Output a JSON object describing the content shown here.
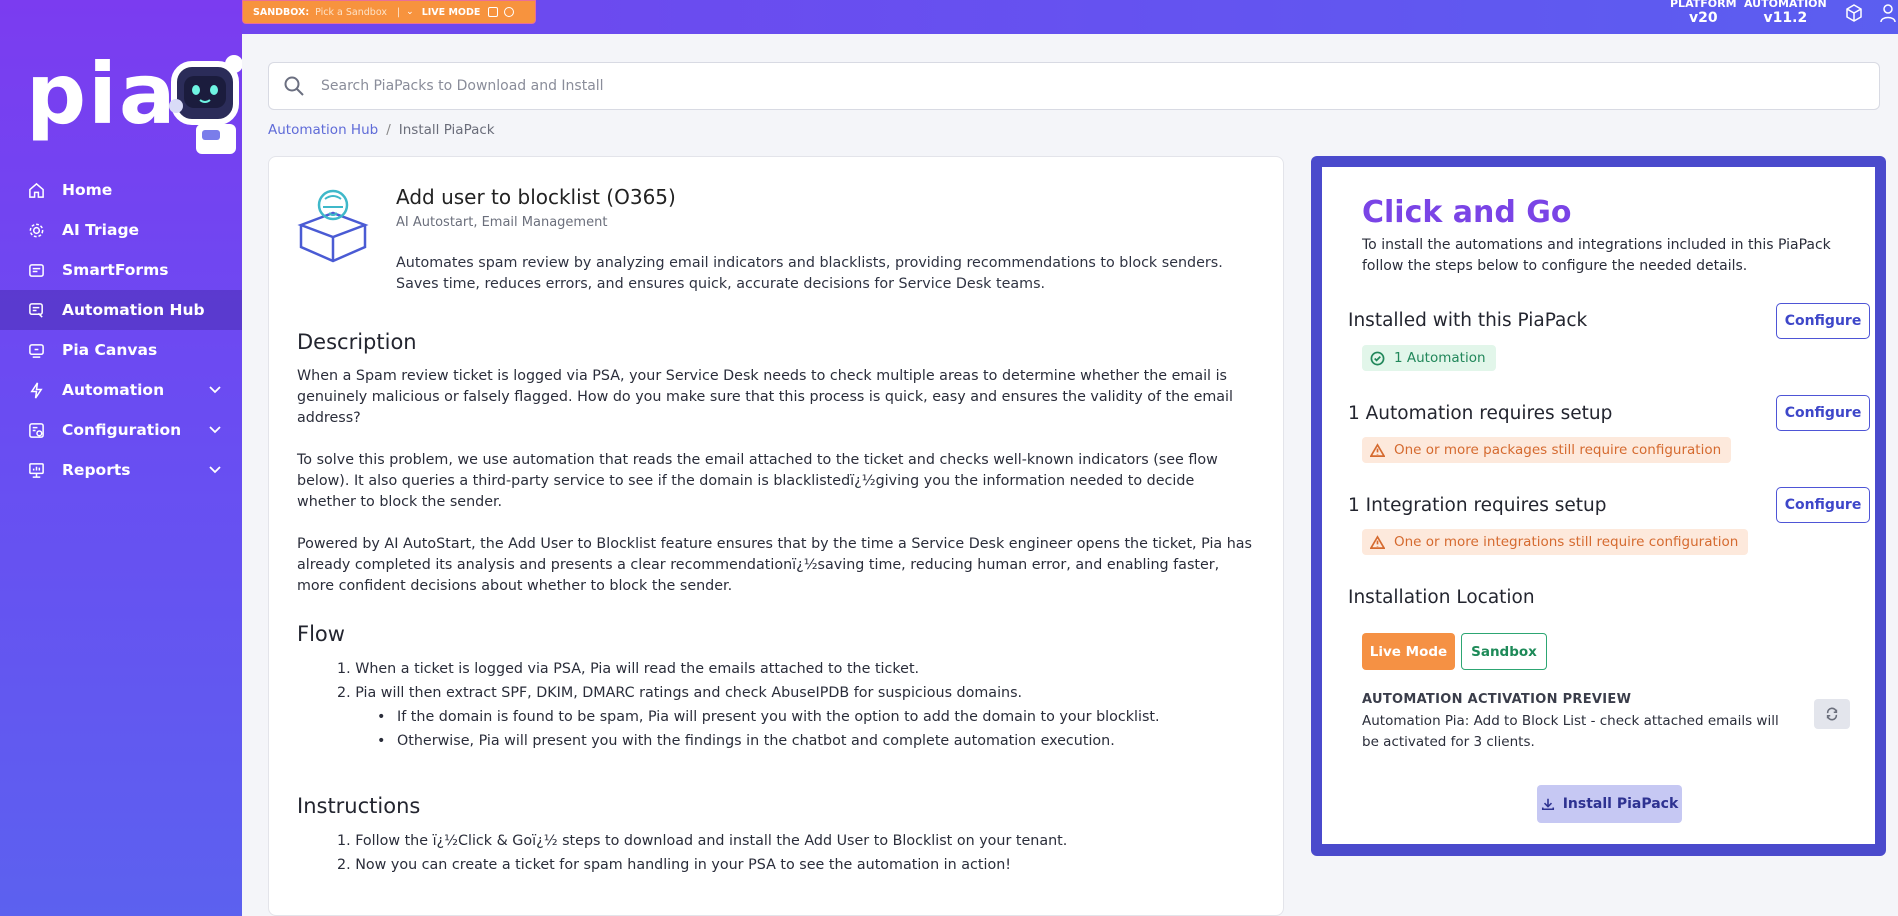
{
  "topbar": {
    "sandbox_label": "SANDBOX:",
    "sandbox_pick": "Pick a Sandbox",
    "live_mode": "LIVE MODE",
    "platform_label": "PLATFORM",
    "platform_version": "v20",
    "automation_label": "AUTOMATION",
    "automation_version": "v11.2",
    "icons": [
      "cube-icon",
      "user-icon"
    ]
  },
  "sidebar": {
    "logo": "pia",
    "items": [
      {
        "label": "Home",
        "icon": "home-icon"
      },
      {
        "label": "AI Triage",
        "icon": "gear-icon"
      },
      {
        "label": "SmartForms",
        "icon": "form-icon"
      },
      {
        "label": "Automation Hub",
        "icon": "hub-icon",
        "active": true
      },
      {
        "label": "Pia Canvas",
        "icon": "canvas-icon"
      },
      {
        "label": "Automation",
        "icon": "bolt-icon",
        "expandable": true
      },
      {
        "label": "Configuration",
        "icon": "config-icon",
        "expandable": true
      },
      {
        "label": "Reports",
        "icon": "report-icon",
        "expandable": true
      }
    ]
  },
  "search": {
    "placeholder": "Search PiaPacks to Download and Install",
    "value": ""
  },
  "breadcrumb": {
    "parent": "Automation Hub",
    "separator": "/",
    "current": "Install PiaPack"
  },
  "pack": {
    "title": "Add user to blocklist (O365)",
    "tags": "AI Autostart, Email Management",
    "summary": "Automates spam review by analyzing email indicators and blacklists, providing recommendations to block senders. Saves time, reduces errors, and ensures quick, accurate decisions for Service Desk teams.",
    "description_heading": "Description",
    "description_p1": "When a Spam review ticket is logged via PSA, your Service Desk needs to check multiple areas to determine whether the email is genuinely malicious or falsely flagged. How do you make sure that this process is quick, easy and ensures the validity of the email address?",
    "description_p2": "To solve this problem, we use automation that reads the email attached to the ticket and checks well-known indicators (see flow below). It also queries a third-party service to see if the domain is blacklistedï¿½giving you the information needed to decide whether to block the sender.",
    "description_p3": "Powered by AI AutoStart, the Add User to Blocklist feature ensures that by the time a Service Desk engineer opens the ticket, Pia has already completed its analysis and presents a clear recommendationï¿½saving time, reducing human error, and enabling faster, more confident decisions about whether to block the sender.",
    "flow_heading": "Flow",
    "flow_1": "When a ticket is logged via PSA, Pia will read the emails attached to the ticket.",
    "flow_2": "Pia will then extract SPF, DKIM, DMARC ratings and check AbuseIPDB for suspicious domains.",
    "flow_2a": "If the domain is found to be spam, Pia will present you with the option to add the domain to your blocklist.",
    "flow_2b": "Otherwise, Pia will present you with the findings in the chatbot and complete automation execution.",
    "instructions_heading": "Instructions",
    "instr_1": "Follow the ï¿½Click & Goï¿½ steps to download and install the Add User to Blocklist on your tenant.",
    "instr_2": "Now you can create a ticket for spam handling in your PSA to see the automation in action!"
  },
  "click_and_go": {
    "title": "Click and Go",
    "subtitle": "To install the automations and integrations included in this PiaPack follow the steps below to configure the needed details.",
    "installed_heading": "Installed with this PiaPack",
    "installed_badge": "1 Automation",
    "automation_heading": "1 Automation requires setup",
    "automation_badge": "One or more packages still require configuration",
    "integration_heading": "1 Integration requires setup",
    "integration_badge": "One or more integrations still require configuration",
    "configure_label": "Configure",
    "location_heading": "Installation Location",
    "live_mode_label": "Live Mode",
    "sandbox_label": "Sandbox",
    "preview_heading": "AUTOMATION ACTIVATION PREVIEW",
    "preview_text": "Automation Pia: Add to Block List - check attached emails will be activated for 3 clients.",
    "install_label": "Install PiaPack"
  },
  "colors": {
    "accent": "#7a44e6",
    "panel_border": "#4a4acc",
    "live_mode": "#f59144",
    "sandbox": "#2da673"
  }
}
